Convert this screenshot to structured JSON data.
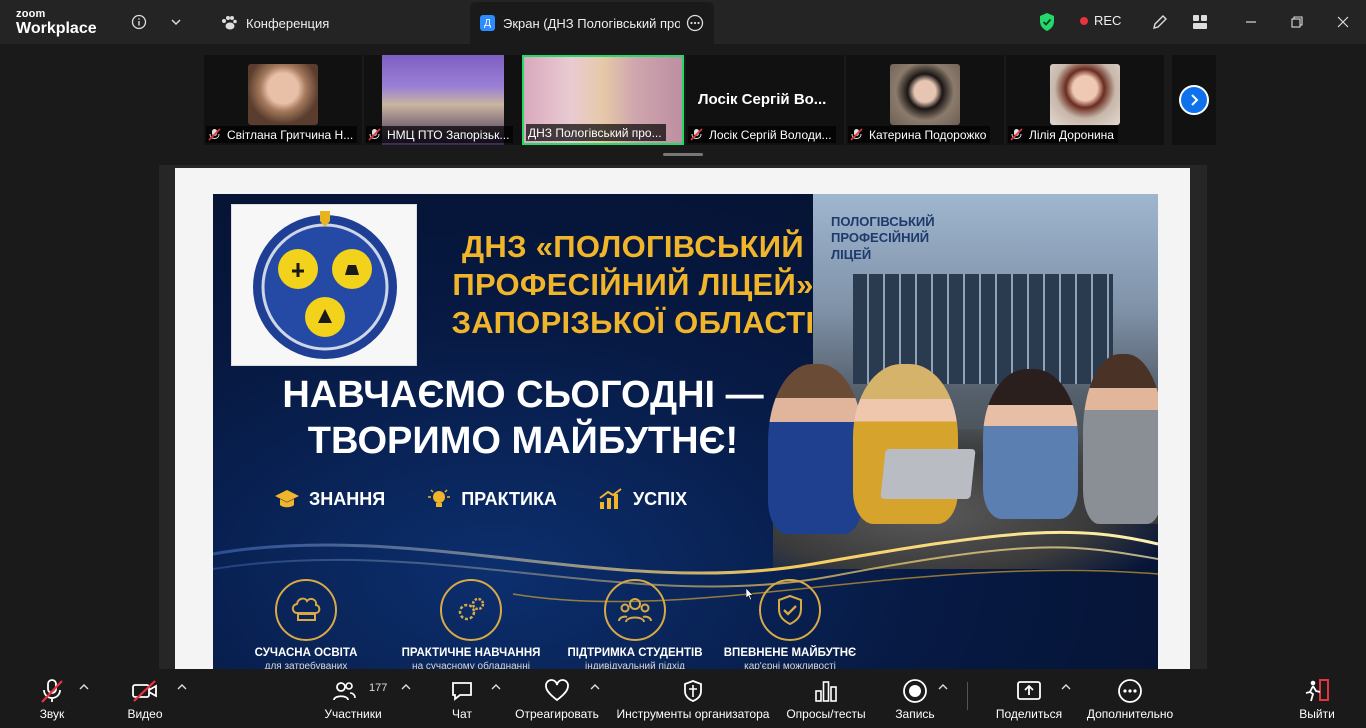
{
  "app": {
    "brand_small": "zoom",
    "brand_large": "Workplace"
  },
  "tabs": [
    {
      "label": "Конференция"
    },
    {
      "label": "Экран (ДНЗ Пологівський проф",
      "avatar_letter": "Д"
    }
  ],
  "recording": {
    "label": "REC"
  },
  "participants_strip": [
    {
      "name": "Світлана Гритчина Н..."
    },
    {
      "name": "НМЦ ПТО Запорізьк..."
    },
    {
      "name": "ДНЗ Пологівський про..."
    },
    {
      "name": "Лосік Сергій Володи...",
      "big_name": "Лосік Сергій Во..."
    },
    {
      "name": "Катерина Подорожко"
    },
    {
      "name": "Лілія Доронина"
    }
  ],
  "slide": {
    "logo_arc_text": "ДЕРЖАВНИЙ НАВЧАЛЬНИЙ ЗАКЛАД \"ПОЛОГІВСЬКИЙ ПРОФЕСІЙНИЙ ЛІЦЕЙ\"",
    "building_sign": "ПОЛОГІВСЬКИЙ ПРОФЕСІЙНИЙ ЛІЦЕЙ",
    "title_lines": [
      "ДНЗ «ПОЛОГІВСЬКИЙ",
      "ПРОФЕСІЙНИЙ ЛІЦЕЙ»",
      "ЗАПОРІЗЬКОЇ ОБЛАСТІ"
    ],
    "slogan_lines": [
      "НАВЧАЄМО СЬОГОДНІ —",
      "ТВОРИМО МАЙБУТНЄ!"
    ],
    "features": [
      "ЗНАННЯ",
      "ПРАКТИКА",
      "УСПІХ"
    ],
    "cards": [
      {
        "title": "СУЧАСНА ОСВІТА",
        "subtitle": "для затребуваних"
      },
      {
        "title": "ПРАКТИЧНЕ НАВЧАННЯ",
        "subtitle": "на сучасному обладнанні"
      },
      {
        "title": "ПІДТРИМКА СТУДЕНТІВ",
        "subtitle": "індивідуальний підхід"
      },
      {
        "title": "ВПЕВНЕНЕ МАЙБУТНЄ",
        "subtitle": "кар'єрні можливості"
      }
    ]
  },
  "toolbar": {
    "audio": "Звук",
    "video": "Видео",
    "participants": "Участники",
    "participants_count": "177",
    "chat": "Чат",
    "react": "Отреагировать",
    "host_tools": "Инструменты организатора",
    "polls": "Опросы/тесты",
    "record": "Запись",
    "share": "Поделиться",
    "more": "Дополнительно",
    "leave": "Выйти"
  },
  "colors": {
    "accent": "#0e72ed",
    "active_border": "#23d96a",
    "rec": "#e8333f",
    "slide_gold": "#f0b52b"
  }
}
